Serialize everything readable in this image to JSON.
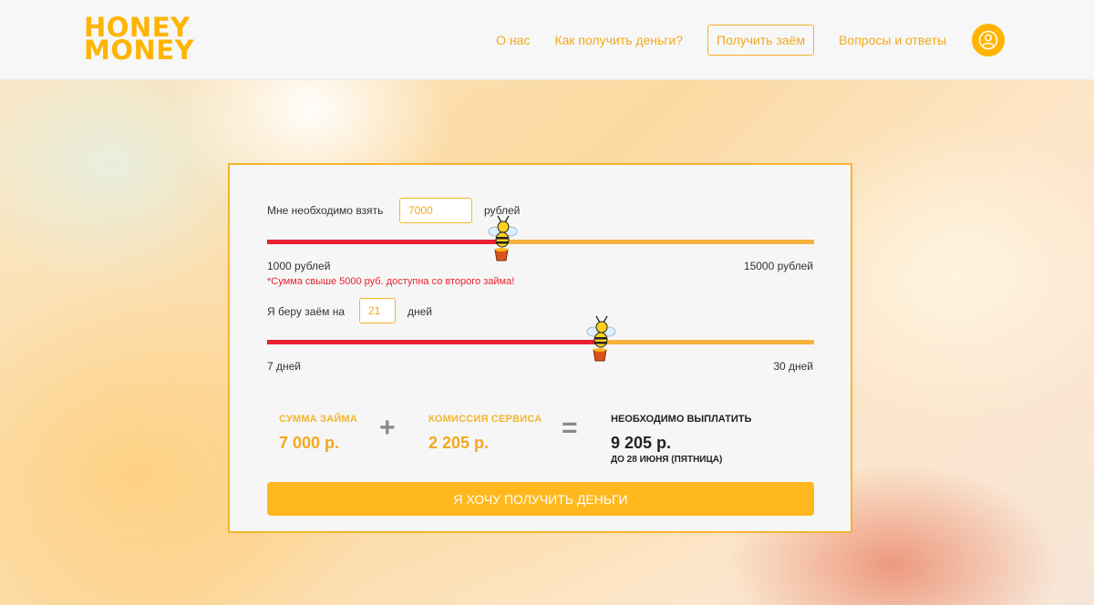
{
  "header": {
    "logo_line1": "HONEY",
    "logo_line2": "MONEY",
    "nav": {
      "about": "О нас",
      "how": "Как получить деньги?",
      "get_loan": "Получить заём",
      "faq": "Вопросы и ответы"
    },
    "user_icon": "user-icon"
  },
  "calculator": {
    "amount": {
      "label": "Мне необходимо взять",
      "value": "7000",
      "unit": "рублей",
      "min_label": "1000 рублей",
      "max_label": "15000 рублей",
      "min": 1000,
      "max": 15000,
      "current": 7000,
      "note": "*Сумма свыше 5000 руб. доступна со второго займа!"
    },
    "term": {
      "label": "Я беру заём на",
      "value": "21",
      "unit": "дней",
      "min_label": "7 дней",
      "max_label": "30 дней",
      "min": 7,
      "max": 30,
      "current": 21
    },
    "summary": {
      "loan_title": "СУММА ЗАЙМА",
      "loan_value": "7 000 р.",
      "plus": "+",
      "fee_title": "КОМИССИЯ СЕРВИСА",
      "fee_value": "2 205 р.",
      "equals": "=",
      "total_title": "НЕОБХОДИМО ВЫПЛАТИТЬ",
      "total_value": "9 205 р.",
      "due_date": "ДО 28 ИЮНЯ (ПЯТНИЦА)"
    },
    "cta": "Я ХОЧУ ПОЛУЧИТЬ ДЕНЬГИ"
  },
  "colors": {
    "accent": "#ffb400",
    "progress": "#e8222e",
    "track": "#f6b33c"
  }
}
